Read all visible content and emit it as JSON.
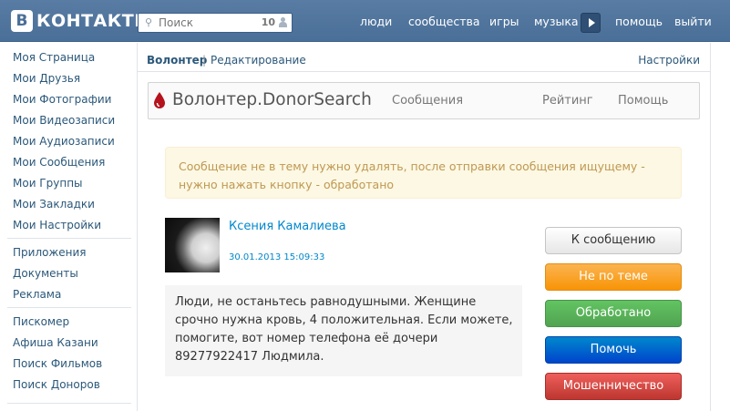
{
  "header": {
    "logo_badge": "В",
    "logo_text": "КОНТАКТЕ",
    "search": {
      "placeholder": "Поиск",
      "count": "10"
    },
    "nav": [
      "люди",
      "сообщества",
      "игры",
      "музыка",
      "помощь",
      "выйти"
    ],
    "colors": {
      "bar": "#4a6f98",
      "link": "#2b587a"
    }
  },
  "sidebar": {
    "group1": [
      "Моя Страница",
      "Мои Друзья",
      "Мои Фотографии",
      "Мои Видеозаписи",
      "Мои Аудиозаписи",
      "Мои Сообщения",
      "Мои Группы",
      "Мои Закладки",
      "Мои Настройки"
    ],
    "group2": [
      "Приложения",
      "Документы",
      "Реклама"
    ],
    "group3": [
      "Пискомер",
      "Афиша Казани",
      "Поиск Фильмов",
      "Поиск Доноров"
    ]
  },
  "app_header": {
    "app_name": "Волонтер",
    "separator": "|",
    "page": "Редактирование",
    "settings": "Настройки"
  },
  "app_nav": {
    "brand": "Волонтер.DonorSearch",
    "links": [
      "Сообщения",
      "Рейтинг",
      "Помощь"
    ]
  },
  "alert": {
    "text": "Сообщение не в тему нужно удалять, после отправки сообщения ищущему - нужно нажать кнопку - обработано"
  },
  "message": {
    "author": "Ксения Камалиева",
    "date": "30.01.2013 15:09:33",
    "text": "Люди, не останьтесь равнодушными. Женщине срочно нужна кровь, 4 положительная. Если можете, помогите, вот номер телефона её дочери 89277922417 Людмила."
  },
  "actions": {
    "to_message": "К сообщению",
    "off_topic": "Не по теме",
    "processed": "Обработано",
    "help": "Помочь",
    "fraud": "Мошенничество"
  }
}
